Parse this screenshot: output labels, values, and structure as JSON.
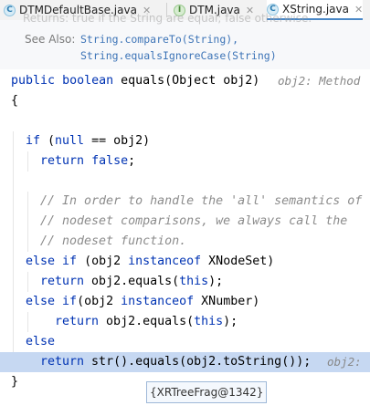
{
  "tabs": [
    {
      "label": "DTMDefaultBase.java",
      "icon": "c-class-icon",
      "active": false
    },
    {
      "label": "DTM.java",
      "icon": "i-interface-icon",
      "active": false
    },
    {
      "label": "XString.java",
      "icon": "c-class-icon",
      "active": true
    }
  ],
  "doc": {
    "faded_line": "Returns:  true if the String are equal; false otherwise.",
    "see_also_label": "See Also:",
    "links": [
      "String.compareTo(String),",
      "String.equalsIgnoreCase(String)"
    ]
  },
  "code": {
    "sig_public": "public",
    "sig_boolean": "boolean",
    "sig_name": "equals(Object obj2)",
    "sig_hint": "obj2: Method",
    "open_brace": "{",
    "if_kw": "if",
    "if_cond_a": " (",
    "null_kw": "null",
    "if_cond_b": " == obj2)",
    "return_kw": "return",
    "false_kw": "false",
    "semicolon": ";",
    "comment1": "// In order to handle the 'all' semantics of",
    "comment2": "// nodeset comparisons, we always call the",
    "comment3": "// nodeset function.",
    "else_kw": "else",
    "elseif_a_rest": " (obj2 ",
    "instanceof_kw": "instanceof",
    "xnodeset": " XNodeSet)",
    "obj2_equals_this_a": " obj2.equals(",
    "this_kw": "this",
    "close_paren_semi": ");",
    "elseif_b_rest": "(obj2 ",
    "xnumber": " XNumber)",
    "last_return_rest": " str().equals(obj2.toString());",
    "last_hint": "obj2:",
    "close_brace": "}"
  },
  "tooltip": "{XRTreeFrag@1342}",
  "colors": {
    "keyword": "#0033b3",
    "comment": "#8c8c8c",
    "highlight_line": "#c6d8f2",
    "link": "#3d74b7"
  }
}
